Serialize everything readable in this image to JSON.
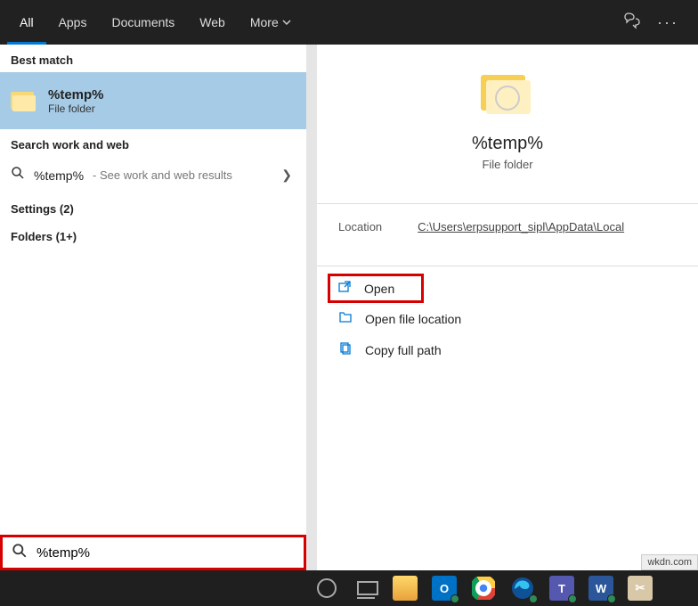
{
  "tabs": {
    "all": "All",
    "apps": "Apps",
    "documents": "Documents",
    "web": "Web",
    "more": "More"
  },
  "left_pane": {
    "best_match_header": "Best match",
    "best_match": {
      "title": "%temp%",
      "subtitle": "File folder"
    },
    "search_section_header": "Search work and web",
    "web_result": {
      "query": "%temp%",
      "hint": " - See work and web results"
    },
    "settings_header": "Settings (2)",
    "folders_header": "Folders (1+)"
  },
  "right_pane": {
    "title": "%temp%",
    "subtitle": "File folder",
    "location_label": "Location",
    "location_path": "C:\\Users\\erpsupport_sipl\\AppData\\Local",
    "actions": {
      "open": "Open",
      "open_location": "Open file location",
      "copy_path": "Copy full path"
    }
  },
  "search": {
    "value": "%temp%"
  },
  "watermark": "wkdn.com"
}
